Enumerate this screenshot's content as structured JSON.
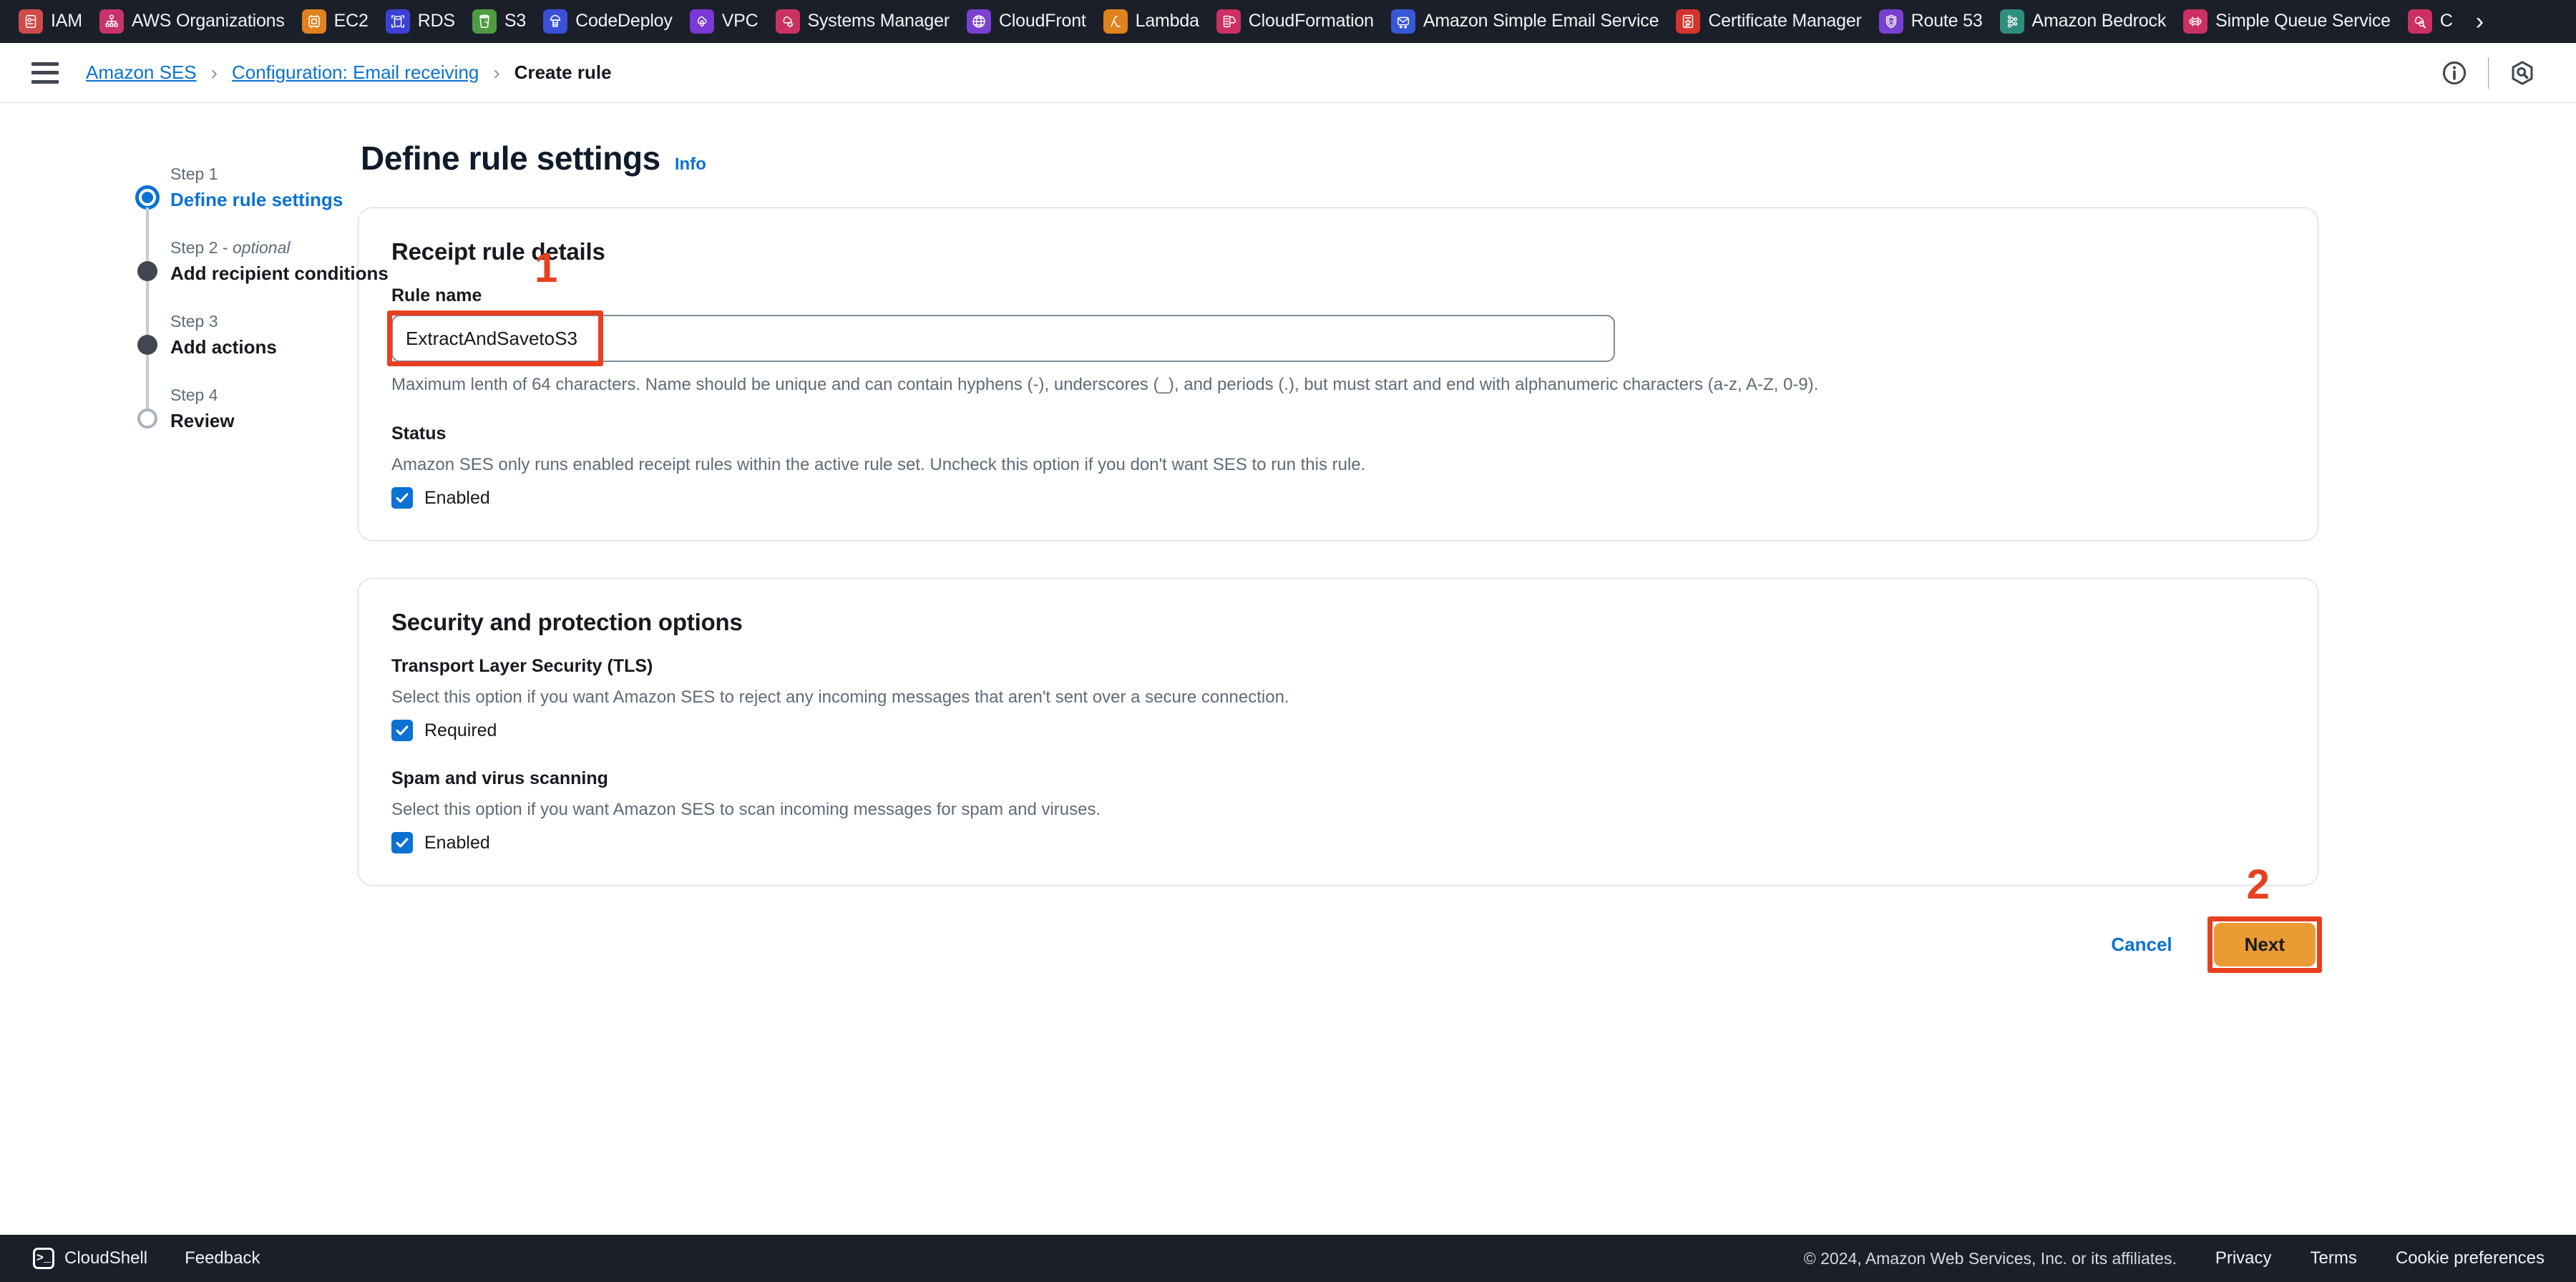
{
  "bookmarks": [
    {
      "label": "IAM",
      "icon": "iam-icon",
      "color": "#cf4b4b"
    },
    {
      "label": "AWS Organizations",
      "icon": "organizations-icon",
      "color": "#c9336b"
    },
    {
      "label": "EC2",
      "icon": "ec2-icon",
      "color": "#e0821f"
    },
    {
      "label": "RDS",
      "icon": "rds-icon",
      "color": "#3c41d6"
    },
    {
      "label": "S3",
      "icon": "s3-icon",
      "color": "#4f9c42"
    },
    {
      "label": "CodeDeploy",
      "icon": "codedeploy-icon",
      "color": "#3b4fd8"
    },
    {
      "label": "VPC",
      "icon": "vpc-icon",
      "color": "#7a38d6"
    },
    {
      "label": "Systems Manager",
      "icon": "systems-manager-icon",
      "color": "#c9335f"
    },
    {
      "label": "CloudFront",
      "icon": "cloudfront-icon",
      "color": "#7a41d1"
    },
    {
      "label": "Lambda",
      "icon": "lambda-icon",
      "color": "#e0821f"
    },
    {
      "label": "CloudFormation",
      "icon": "cloudformation-icon",
      "color": "#cb2f63"
    },
    {
      "label": "Amazon Simple Email Service",
      "icon": "ses-icon",
      "color": "#3557d8"
    },
    {
      "label": "Certificate Manager",
      "icon": "certificate-manager-icon",
      "color": "#d4342c"
    },
    {
      "label": "Route 53",
      "icon": "route53-icon",
      "color": "#7a41d1"
    },
    {
      "label": "Amazon Bedrock",
      "icon": "bedrock-icon",
      "color": "#2f8f7d"
    },
    {
      "label": "Simple Queue Service",
      "icon": "sqs-icon",
      "color": "#cb2f63"
    },
    {
      "label": "C",
      "icon": "cloudwatch-logs-icon",
      "color": "#cb2f63"
    }
  ],
  "bookmarks_overflow": "›",
  "breadcrumb": {
    "items": [
      {
        "label": "Amazon SES",
        "type": "link"
      },
      {
        "label": "Configuration: Email receiving",
        "type": "link"
      },
      {
        "label": "Create rule",
        "type": "current"
      }
    ],
    "separator": "›"
  },
  "stepnav": [
    {
      "kicker": "Step 1",
      "kicker_italic": "",
      "title": "Define rule settings",
      "state": "active"
    },
    {
      "kicker": "Step 2 - ",
      "kicker_italic": "optional",
      "title": "Add recipient conditions",
      "state": "done"
    },
    {
      "kicker": "Step 3",
      "kicker_italic": "",
      "title": "Add actions",
      "state": "done"
    },
    {
      "kicker": "Step 4",
      "kicker_italic": "",
      "title": "Review",
      "state": "pending"
    }
  ],
  "main": {
    "title": "Define rule settings",
    "info_label": "Info",
    "receipt_card": {
      "title": "Receipt rule details",
      "rule_name_label": "Rule name",
      "rule_name_value": "ExtractAndSavetoS3",
      "rule_name_placeholder": "",
      "rule_name_helper": "Maximum lenth of 64 characters. Name should be unique and can contain hyphens (-), underscores (_), and periods (.), but must start and end with alphanumeric characters (a-z, A-Z, 0-9).",
      "status_label": "Status",
      "status_desc": "Amazon SES only runs enabled receipt rules within the active rule set. Uncheck this option if you don't want SES to run this rule.",
      "status_checkbox_label": "Enabled",
      "status_checked": true
    },
    "security_card": {
      "title": "Security and protection options",
      "tls_label": "Transport Layer Security (TLS)",
      "tls_desc": "Select this option if you want Amazon SES to reject any incoming messages that aren't sent over a secure connection.",
      "tls_checkbox_label": "Required",
      "tls_checked": true,
      "spam_label": "Spam and virus scanning",
      "spam_desc": "Select this option if you want Amazon SES to scan incoming messages for spam and viruses.",
      "spam_checkbox_label": "Enabled",
      "spam_checked": true
    },
    "actions": {
      "cancel_label": "Cancel",
      "next_label": "Next"
    }
  },
  "annotations": [
    {
      "number": "1",
      "target": "rule-name-input"
    },
    {
      "number": "2",
      "target": "next-button"
    }
  ],
  "footer": {
    "cloudshell_label": "CloudShell",
    "feedback_label": "Feedback",
    "copyright": "© 2024, Amazon Web Services, Inc. or its affiliates.",
    "privacy_label": "Privacy",
    "terms_label": "Terms",
    "cookie_label": "Cookie preferences"
  },
  "colors": {
    "accent_blue": "#0972d3",
    "annotation_red": "#e8401f",
    "next_orange": "#eb9b33",
    "dark_bar": "#1b1f2a"
  }
}
